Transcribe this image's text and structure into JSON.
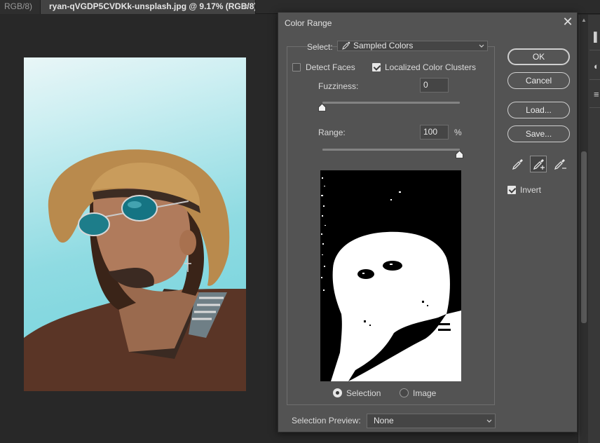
{
  "tabs": {
    "inactive_label": "RGB/8)",
    "active_label": "ryan-qVGDP5CVDKk-unsplash.jpg @ 9.17% (RGB/8)",
    "close_glyph": "×"
  },
  "dialog": {
    "title": "Color Range",
    "close_glyph": "✕",
    "select_label": "Select:",
    "select_value": "Sampled Colors",
    "detect_faces_label": "Detect Faces",
    "detect_faces_checked": false,
    "localized_label": "Localized Color Clusters",
    "localized_checked": true,
    "fuzziness_label": "Fuzziness:",
    "fuzziness_value": "0",
    "fuzziness_slider": 0,
    "range_label": "Range:",
    "range_value": "100",
    "range_unit": "%",
    "range_slider": 1.0,
    "preview_mode": {
      "selection_label": "Selection",
      "image_label": "Image",
      "selected": "selection"
    },
    "selection_preview_label": "Selection Preview:",
    "selection_preview_value": "None",
    "buttons": {
      "ok": "OK",
      "cancel": "Cancel",
      "load": "Load...",
      "save": "Save..."
    },
    "tools": [
      "eyedropper-icon",
      "eyedropper-plus-icon",
      "eyedropper-minus-icon"
    ],
    "selected_tool": "eyedropper-plus-icon",
    "invert_label": "Invert",
    "invert_checked": true
  },
  "colors": {
    "dialog_bg": "#535353",
    "app_bg": "#282828",
    "sky": "#7fd6de",
    "hat": "#b98a4d"
  }
}
